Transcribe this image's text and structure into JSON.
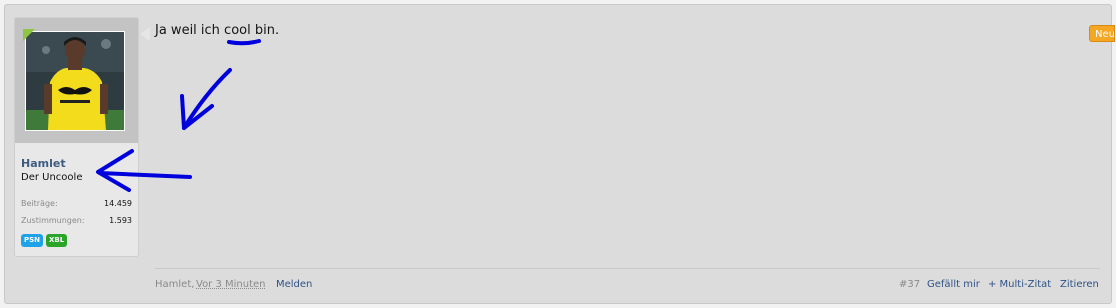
{
  "post": {
    "message": "Ja weil ich cool bin.",
    "new_badge": "Neu",
    "author": {
      "name": "Hamlet",
      "title": "Der Uncoole",
      "stats": [
        {
          "label": "Beiträge:",
          "value": "14.459"
        },
        {
          "label": "Zustimmungen:",
          "value": "1.593"
        }
      ],
      "badges": [
        {
          "label": "PSN",
          "color": "#1fa2e8"
        },
        {
          "label": "XBL",
          "color": "#2aa52a"
        }
      ]
    },
    "footer": {
      "author": "Hamlet,",
      "time": "Vor 3 Minuten",
      "report": "Melden",
      "number": "#37",
      "like": "Gefällt mir",
      "multiquote": "+ Multi-Zitat",
      "quote": "Zitieren"
    }
  },
  "colors": {
    "link": "#2f5386",
    "annotation": "#0000dd",
    "new_badge": "#f5a623"
  }
}
